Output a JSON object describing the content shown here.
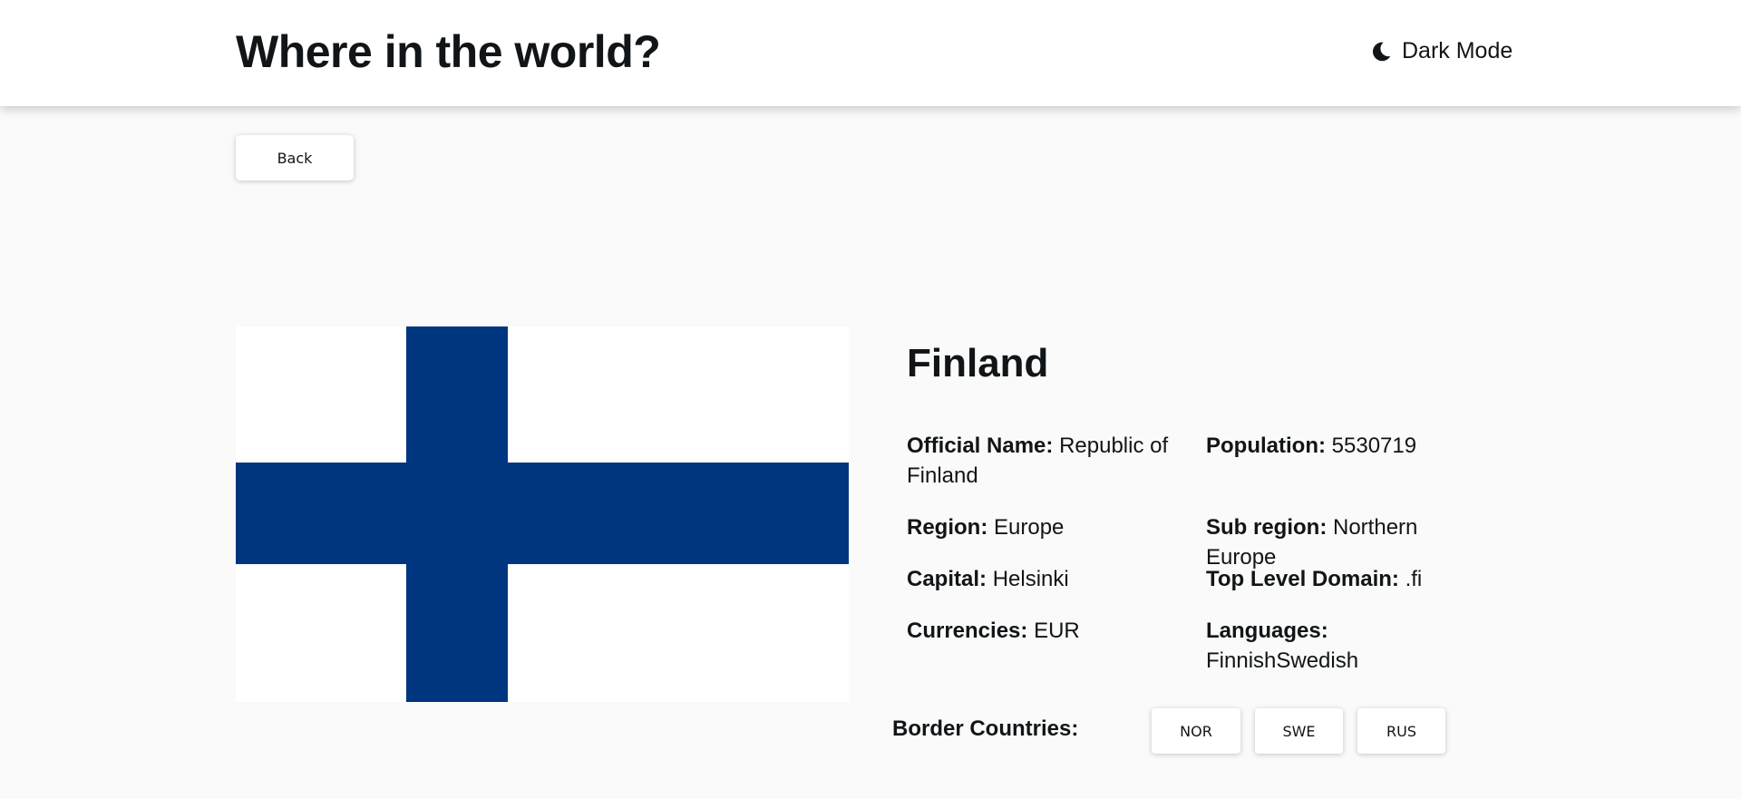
{
  "header": {
    "title": "Where in the world?",
    "mode_toggle_label": "Dark Mode",
    "mode_icon": "moon-icon"
  },
  "nav": {
    "back_label": "Back"
  },
  "country": {
    "name": "Finland",
    "flag": {
      "icon": "finland-flag",
      "field_color": "#ffffff",
      "cross_color": "#003580"
    },
    "details_left": [
      {
        "label": "Official Name:",
        "value": "Republic of Finland"
      },
      {
        "label": "Region:",
        "value": "Europe"
      },
      {
        "label": "Capital:",
        "value": "Helsinki"
      },
      {
        "label": "Currencies:",
        "value": "EUR"
      }
    ],
    "details_right": [
      {
        "label": "Population:",
        "value": "5530719"
      },
      {
        "label": "Sub region:",
        "value": "Northern Europe"
      },
      {
        "label": "Top Level Domain:",
        "value": ".fi"
      },
      {
        "label": "Languages:",
        "value": "FinnishSwedish"
      }
    ],
    "border_label": "Border Countries:",
    "borders": [
      "NOR",
      "SWE",
      "RUS"
    ]
  }
}
